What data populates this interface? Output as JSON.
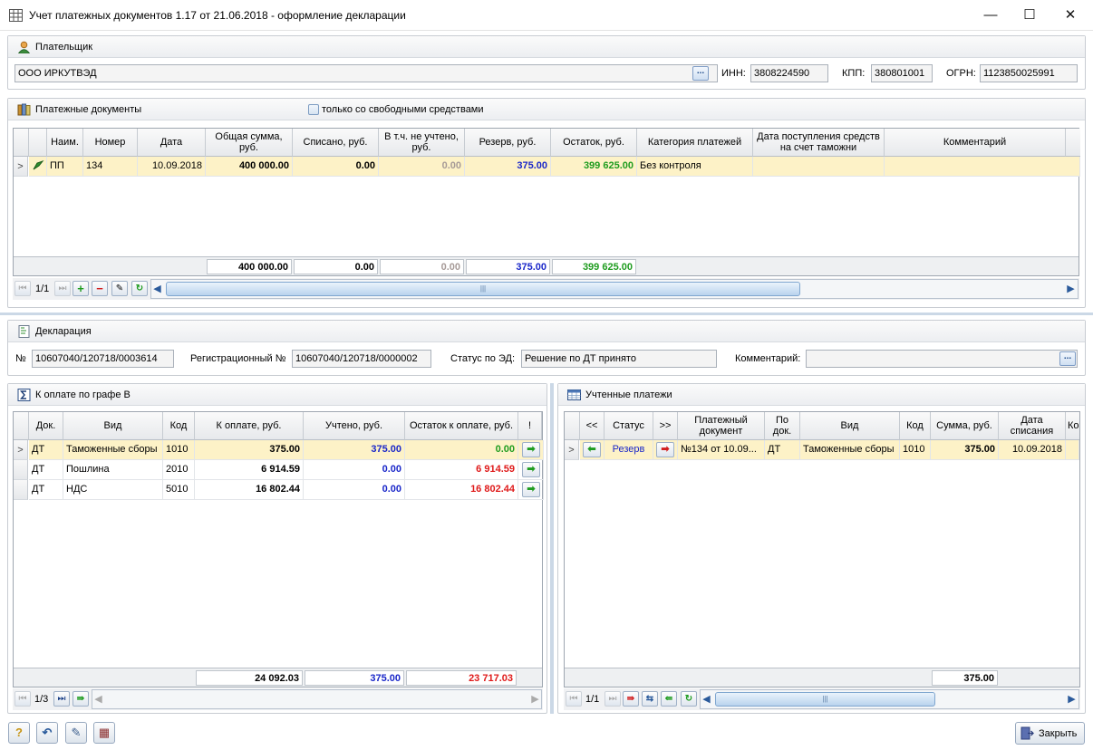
{
  "window": {
    "title": "Учет платежных документов 1.17 от 21.06.2018 - оформление декларации",
    "minimize": "—",
    "maximize": "☐",
    "close": "✕"
  },
  "payer": {
    "header": "Плательщик",
    "name": "ООО ИРКУТВЭД",
    "inn_label": "ИНН:",
    "inn": "3808224590",
    "kpp_label": "КПП:",
    "kpp": "380801001",
    "ogrn_label": "ОГРН:",
    "ogrn": "1123850025991",
    "browse": "..."
  },
  "payments": {
    "header": "Платежные документы",
    "filter_label": "только со свободными средствами",
    "columns": [
      "Наим.",
      "Номер",
      "Дата",
      "Общая сумма, руб.",
      "Списано, руб.",
      "В т.ч. не учтено, руб.",
      "Резерв, руб.",
      "Остаток, руб.",
      "Категория платежей",
      "Дата поступления средств на счет таможни",
      "Комментарий"
    ],
    "rows": [
      {
        "indicator": ">",
        "name": "ПП",
        "number": "134",
        "date": "10.09.2018",
        "total": "400 000.00",
        "written_off": "0.00",
        "not_counted": "0.00",
        "reserve": "375.00",
        "balance": "399 625.00",
        "category": "Без контроля",
        "received": "",
        "comment": ""
      }
    ],
    "totals": {
      "total": "400 000.00",
      "written_off": "0.00",
      "not_counted": "0.00",
      "reserve": "375.00",
      "balance": "399 625.00"
    },
    "page": "1/1"
  },
  "declaration": {
    "header": "Декларация",
    "number_label": "№",
    "number": "10607040/120718/0003614",
    "reg_label": "Регистрационный №",
    "reg_number": "10607040/120718/0000002",
    "status_label": "Статус по ЭД:",
    "status": "Решение по ДТ принято",
    "comment_label": "Комментарий:",
    "comment": "",
    "browse": "..."
  },
  "to_pay": {
    "header": "К оплате по графе В",
    "columns": [
      "Док.",
      "Вид",
      "Код",
      "К оплате, руб.",
      "Учтено, руб.",
      "Остаток к оплате, руб.",
      "!"
    ],
    "rows": [
      {
        "indicator": ">",
        "doc": "ДТ",
        "kind": "Таможенные сборы",
        "code": "1010",
        "to_pay": "375.00",
        "counted": "375.00",
        "rest": "0.00",
        "rest_color": "green"
      },
      {
        "indicator": "",
        "doc": "ДТ",
        "kind": "Пошлина",
        "code": "2010",
        "to_pay": "6 914.59",
        "counted": "0.00",
        "rest": "6 914.59",
        "rest_color": "red"
      },
      {
        "indicator": "",
        "doc": "ДТ",
        "kind": "НДС",
        "code": "5010",
        "to_pay": "16 802.44",
        "counted": "0.00",
        "rest": "16 802.44",
        "rest_color": "red"
      }
    ],
    "totals": {
      "to_pay": "24 092.03",
      "counted": "375.00",
      "rest": "23 717.03"
    },
    "page": "1/3"
  },
  "counted": {
    "header": "Учтенные платежи",
    "columns": [
      "<<",
      "Статус",
      ">>",
      "Платежный документ",
      "По док.",
      "Вид",
      "Код",
      "Сумма, руб.",
      "Дата списания",
      "Ко"
    ],
    "rows": [
      {
        "indicator": ">",
        "status": "Резерв",
        "doc": "№134 от 10.09...",
        "by_doc": "ДТ",
        "kind": "Таможенные сборы",
        "code": "1010",
        "sum": "375.00",
        "date": "10.09.2018"
      }
    ],
    "totals": {
      "sum": "375.00"
    },
    "page": "1/1"
  },
  "bottom": {
    "close_label": "Закрыть"
  }
}
